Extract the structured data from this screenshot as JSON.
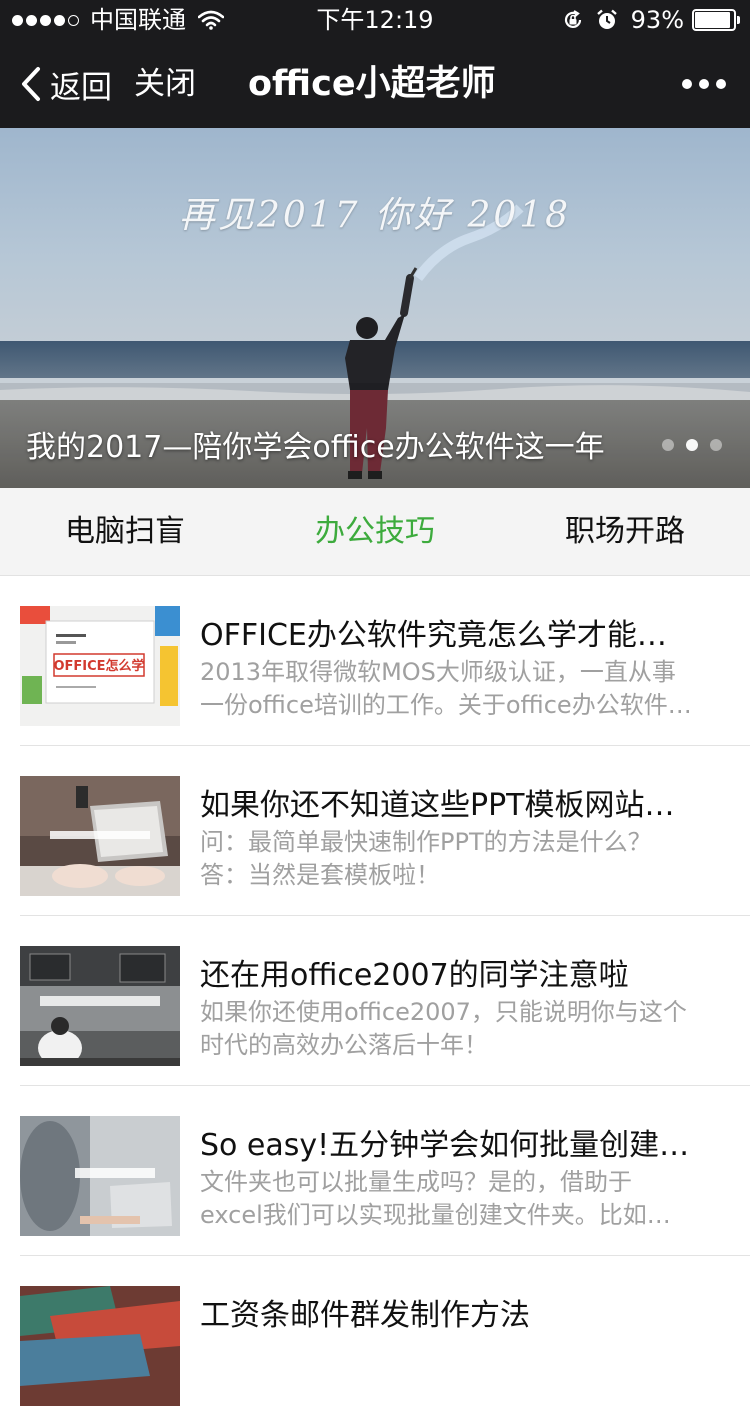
{
  "status_bar": {
    "carrier": "中国联通",
    "time": "下午12:19",
    "battery_percent_text": "93%",
    "battery_level": 0.93,
    "signal_bars_filled": 4,
    "signal_bars_total": 5
  },
  "nav": {
    "back_label": "返回",
    "close_label": "关闭",
    "title": "office小超老师"
  },
  "banner": {
    "handwriting": "再见2017 你好 2018",
    "caption": "我的2017—陪你学会office办公软件这一年",
    "dots_total": 3,
    "active_dot": 1
  },
  "tabs": [
    {
      "label": "电脑扫盲",
      "active": false
    },
    {
      "label": "办公技巧",
      "active": true
    },
    {
      "label": "职场开路",
      "active": false
    }
  ],
  "articles": [
    {
      "title": "OFFICE办公软件究竟怎么学才能…",
      "summary_lines": [
        "2013年取得微软MOS大师级认证，一直从事",
        "一份office培训的工作。关于office办公软件…"
      ],
      "thumb_text": "OFFICE怎么学",
      "thumb_kind": "desk-office"
    },
    {
      "title": "如果你还不知道这些PPT模板网站…",
      "summary_lines": [
        "问：最简单最快速制作PPT的方法是什么？",
        "答：当然是套模板啦！"
      ],
      "thumb_kind": "laptop-hands"
    },
    {
      "title": "还在用office2007的同学注意啦",
      "summary_lines": [
        "如果你还使用office2007，只能说明你与这个",
        "时代的高效办公落后十年！"
      ],
      "thumb_kind": "office-desk-top"
    },
    {
      "title": "So easy!五分钟学会如何批量创建…",
      "summary_lines": [
        "文件夹也可以批量生成吗？是的，借助于",
        "excel我们可以实现批量创建文件夹。比如…"
      ],
      "thumb_kind": "laptop-person"
    },
    {
      "title": "工资条邮件群发制作方法",
      "summary_lines": [],
      "thumb_kind": "money"
    }
  ]
}
